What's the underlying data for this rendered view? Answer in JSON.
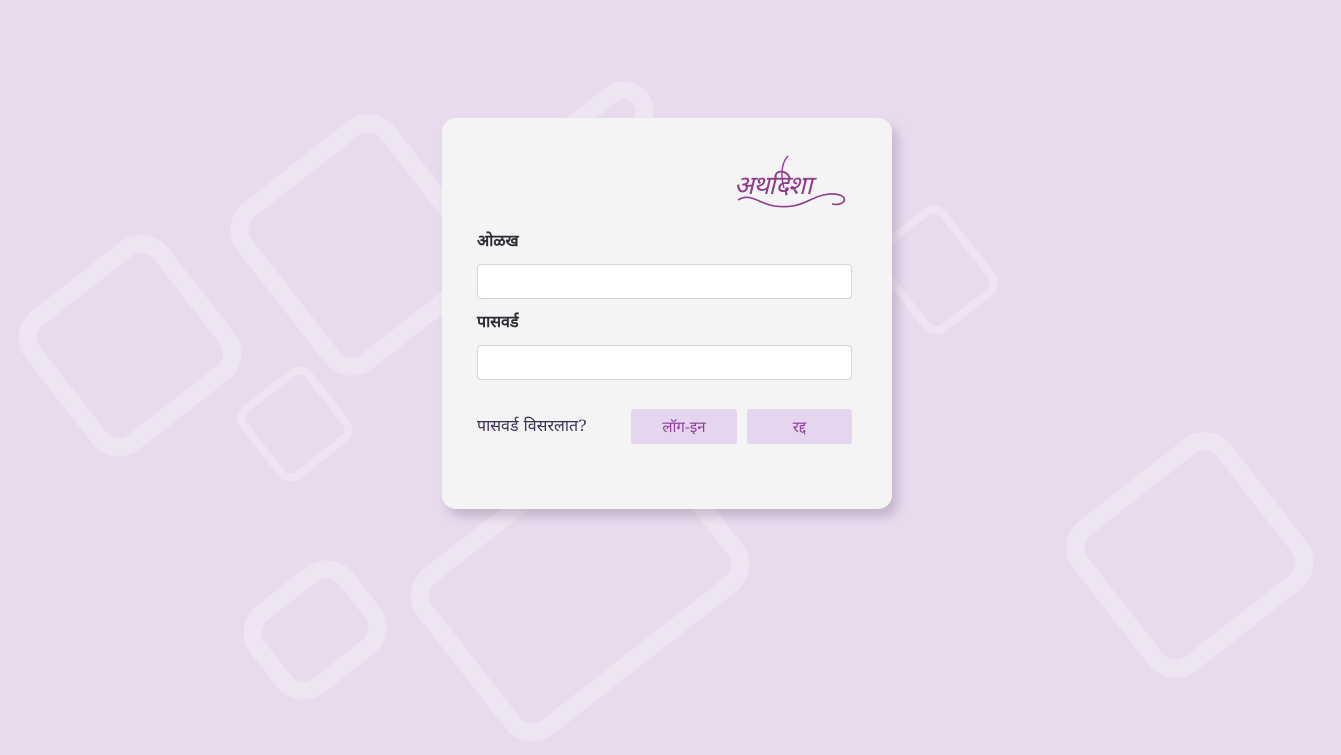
{
  "login": {
    "logo_text": "अथदिशा",
    "username_label": "ओळख",
    "username_value": "",
    "password_label": "पासवर्ड",
    "password_value": "",
    "forgot_password_link": "पासवर्ड विसरलात?",
    "login_button": "लॉग-इन",
    "cancel_button": "रद्द"
  },
  "colors": {
    "background": "#e8dbee",
    "card": "#f4f4f4",
    "brand": "#8e3b8d",
    "button_bg": "#e6d5ee",
    "button_text": "#8b3d96"
  }
}
